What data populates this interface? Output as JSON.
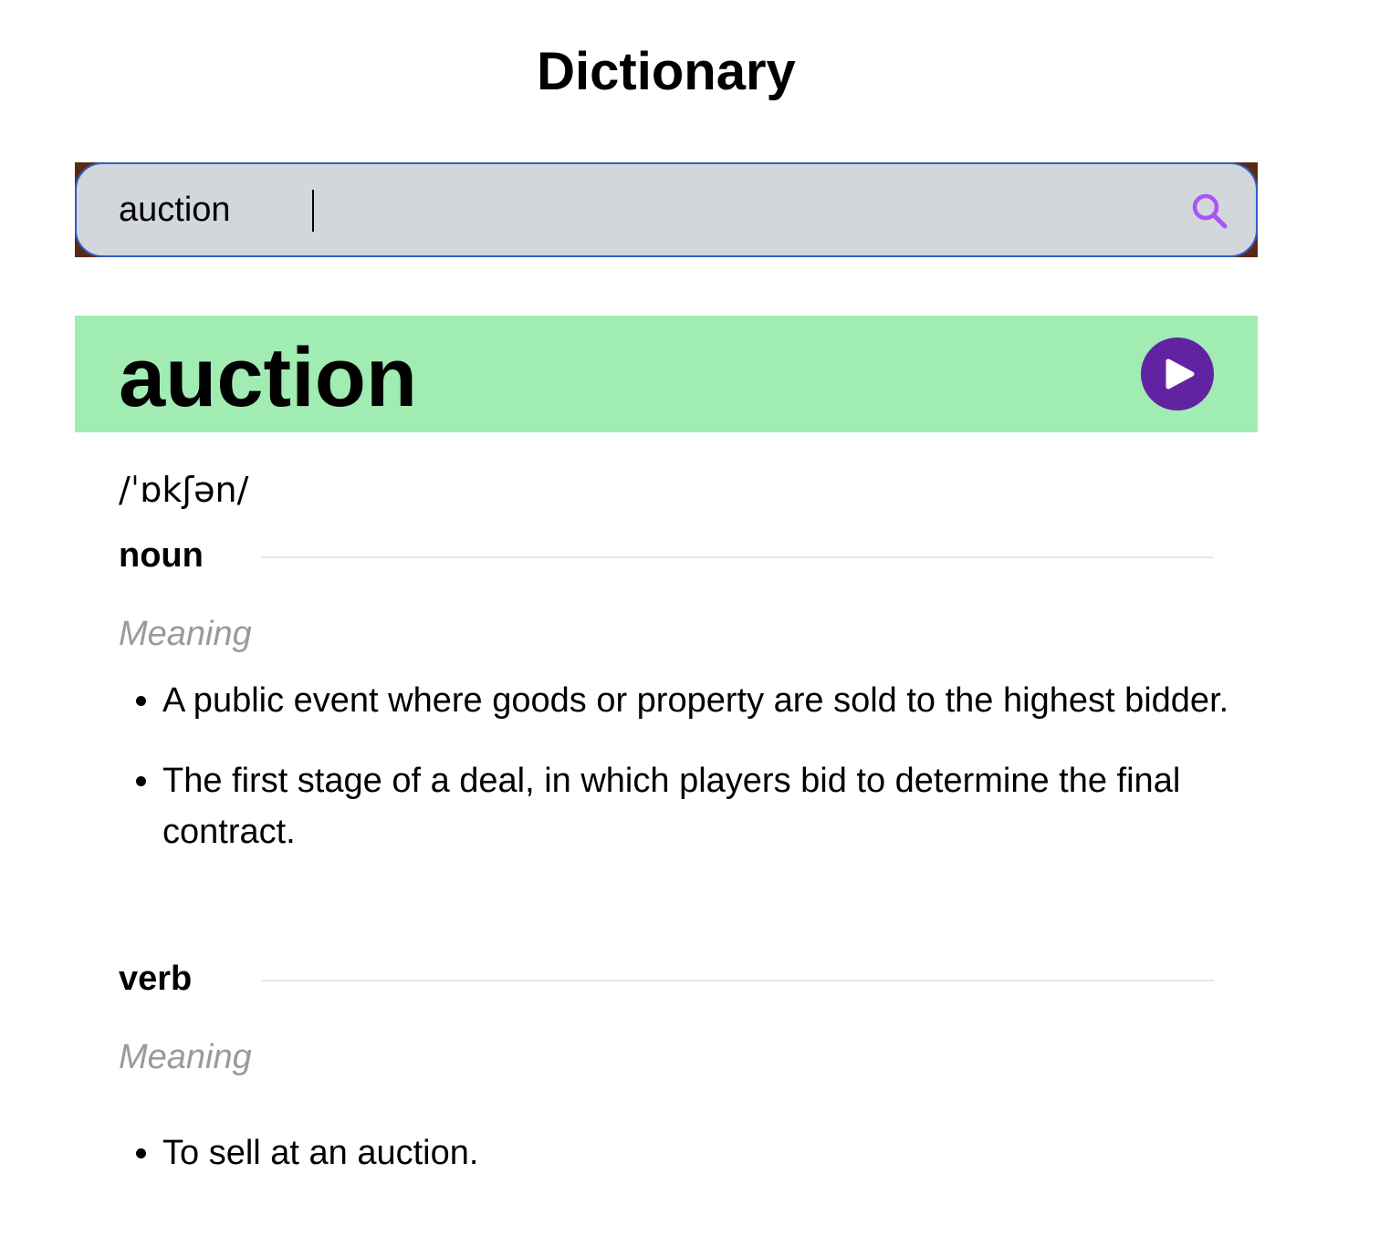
{
  "app": {
    "title": "Dictionary"
  },
  "search": {
    "value": "auction",
    "icon": "search-icon",
    "icon_color": "#a855f7"
  },
  "entry": {
    "word": "auction",
    "phonetic": "/ˈɒkʃən/",
    "banner_color": "#a0ecb3",
    "play_icon": "play-icon",
    "play_color": "#6223a3",
    "meanings": [
      {
        "part_of_speech": "noun",
        "meaning_label": "Meaning",
        "definitions": [
          "A public event where goods or property are sold to the highest bidder.",
          "The first stage of a deal, in which players bid to determine the final contract."
        ]
      },
      {
        "part_of_speech": "verb",
        "meaning_label": "Meaning",
        "definitions": [
          "To sell at an auction."
        ]
      }
    ]
  }
}
